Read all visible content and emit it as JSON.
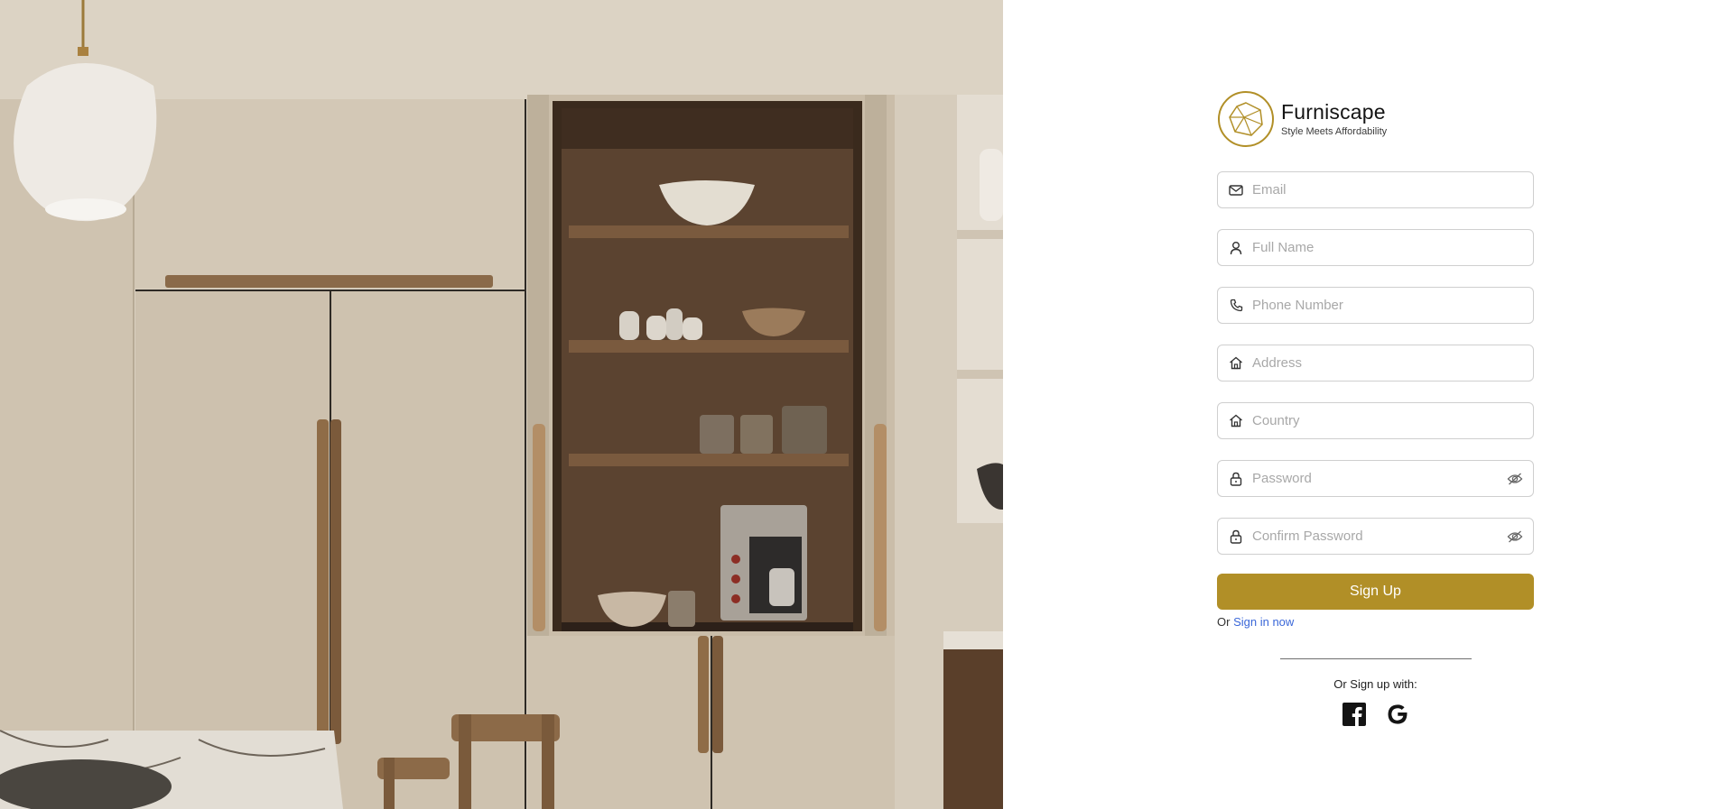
{
  "brand": {
    "name": "Furniscape",
    "tagline": "Style Meets Affordability",
    "logo_icon": "geometric-gem-icon",
    "accent_color": "#b18f27"
  },
  "form": {
    "email": {
      "placeholder": "Email",
      "value": "",
      "icon": "mail-icon"
    },
    "full_name": {
      "placeholder": "Full Name",
      "value": "",
      "icon": "user-icon"
    },
    "phone": {
      "placeholder": "Phone Number",
      "value": "",
      "icon": "phone-icon"
    },
    "address": {
      "placeholder": "Address",
      "value": "",
      "icon": "home-icon"
    },
    "country": {
      "placeholder": "Country",
      "value": "",
      "icon": "home-icon"
    },
    "password": {
      "placeholder": "Password",
      "value": "",
      "icon": "lock-icon",
      "toggle_icon": "eye-off-icon"
    },
    "confirm_password": {
      "placeholder": "Confirm Password",
      "value": "",
      "icon": "lock-icon",
      "toggle_icon": "eye-off-icon"
    },
    "submit_label": "Sign Up"
  },
  "signin": {
    "prefix": "Or",
    "link_text": "Sign in now",
    "link_color": "#3a67d8"
  },
  "social": {
    "heading": "Or Sign up with:",
    "providers": [
      {
        "name": "Facebook",
        "icon": "facebook-icon"
      },
      {
        "name": "Google",
        "icon": "google-icon"
      }
    ]
  }
}
